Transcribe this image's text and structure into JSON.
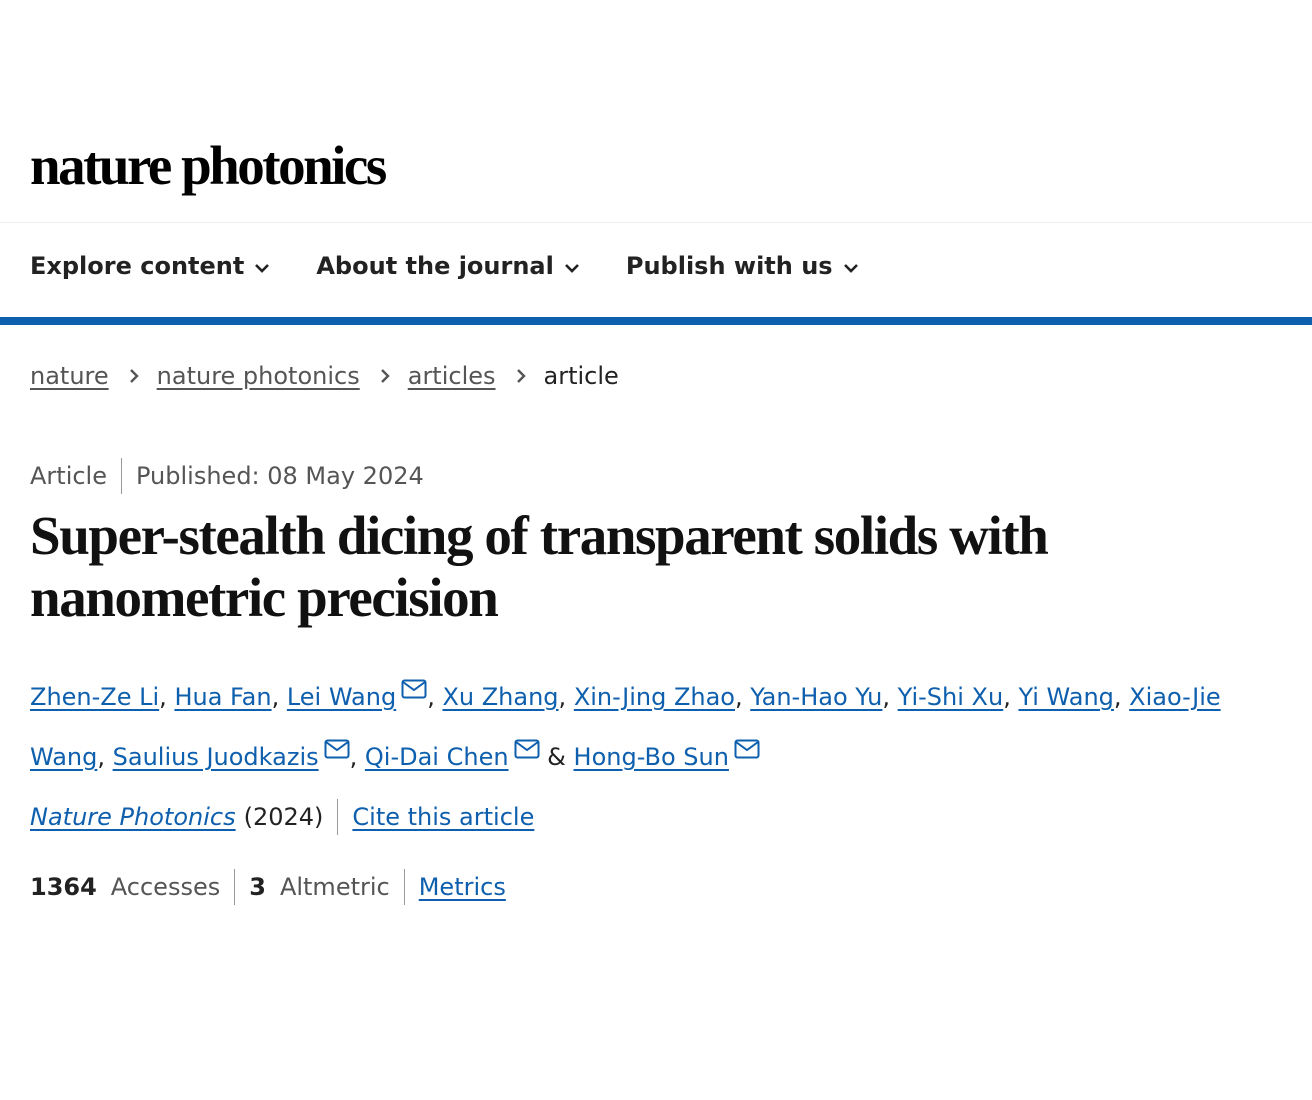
{
  "header": {
    "logo_text": "nature photonics"
  },
  "nav": {
    "items": [
      {
        "label": "Explore content"
      },
      {
        "label": "About the journal"
      },
      {
        "label": "Publish with us"
      }
    ],
    "accent_color": "#0e5fad"
  },
  "breadcrumb": {
    "items": [
      "nature",
      "nature photonics",
      "articles"
    ],
    "current": "article"
  },
  "article": {
    "type": "Article",
    "published": "Published: 08 May 2024",
    "title": "Super-stealth dicing of transparent solids with nanometric precision",
    "authors": [
      {
        "name": "Zhen-Ze Li",
        "email_icon": false
      },
      {
        "name": "Hua Fan",
        "email_icon": false
      },
      {
        "name": "Lei Wang",
        "email_icon": true
      },
      {
        "name": "Xu Zhang",
        "email_icon": false
      },
      {
        "name": "Xin-Jing Zhao",
        "email_icon": false
      },
      {
        "name": "Yan-Hao Yu",
        "email_icon": false
      },
      {
        "name": "Yi-Shi Xu",
        "email_icon": false
      },
      {
        "name": "Yi Wang",
        "email_icon": false
      },
      {
        "name": "Xiao-Jie Wang",
        "email_icon": false
      },
      {
        "name": "Saulius Juodkazis",
        "email_icon": true
      },
      {
        "name": "Qi-Dai Chen",
        "email_icon": true
      },
      {
        "name": "Hong-Bo Sun",
        "email_icon": true
      }
    ],
    "authors_separator": ", ",
    "authors_last_joiner": " & ",
    "journal": "Nature Photonics",
    "year": "(2024)",
    "cite_label": "Cite this article"
  },
  "metrics": {
    "accesses_value": "1364",
    "accesses_label": "Accesses",
    "altmetric_value": "3",
    "altmetric_label": "Altmetric",
    "metrics_link": "Metrics"
  }
}
